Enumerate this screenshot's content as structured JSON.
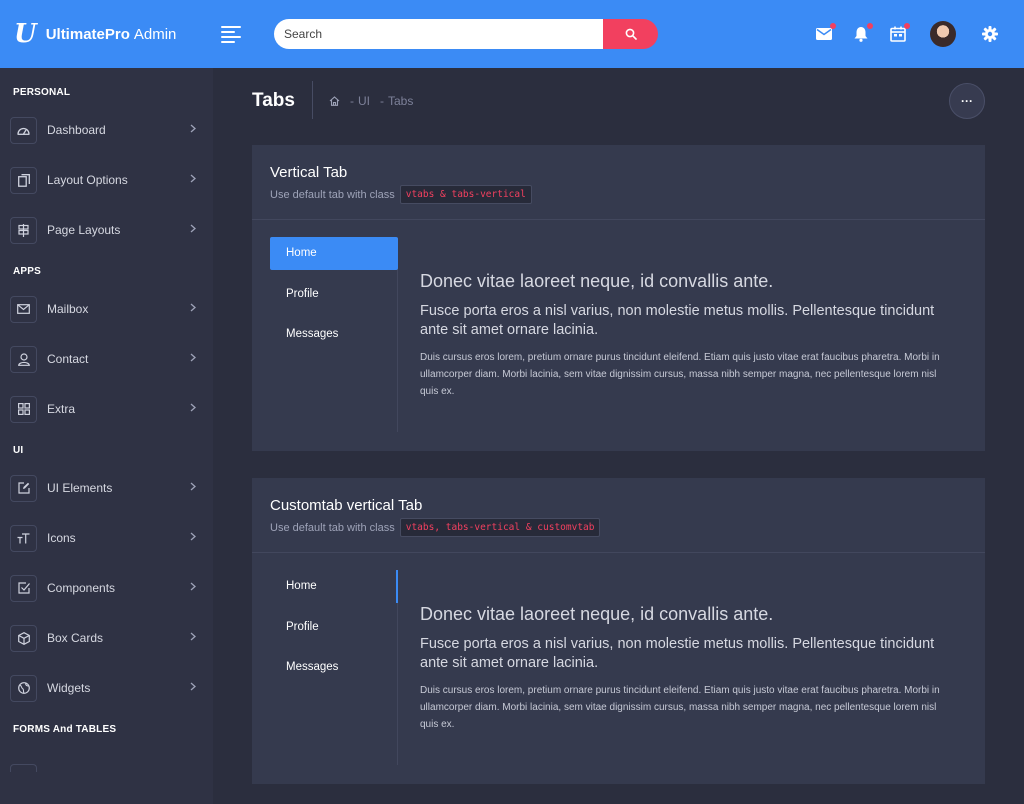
{
  "brand": {
    "logo": "U",
    "name_bold": "UltimatePro",
    "name_light": "Admin"
  },
  "search": {
    "placeholder": "Search"
  },
  "colors": {
    "primary": "#3b8bf5",
    "danger": "#f2405f",
    "sidebar": "#2f3244",
    "content": "#2b2e3e",
    "card": "#353a4e"
  },
  "sidebar": {
    "sections": [
      {
        "title": "PERSONAL",
        "items": [
          {
            "label": "Dashboard",
            "icon": "speedometer-icon"
          },
          {
            "label": "Layout Options",
            "icon": "copy-icon"
          },
          {
            "label": "Page Layouts",
            "icon": "signpost-icon"
          }
        ]
      },
      {
        "title": "APPS",
        "items": [
          {
            "label": "Mailbox",
            "icon": "mail-icon"
          },
          {
            "label": "Contact",
            "icon": "user-icon"
          },
          {
            "label": "Extra",
            "icon": "grid-icon"
          }
        ]
      },
      {
        "title": "UI",
        "items": [
          {
            "label": "UI Elements",
            "icon": "edit-icon"
          },
          {
            "label": "Icons",
            "icon": "text-size-icon"
          },
          {
            "label": "Components",
            "icon": "checkbox-icon"
          },
          {
            "label": "Box Cards",
            "icon": "box-icon"
          },
          {
            "label": "Widgets",
            "icon": "globe-icon"
          }
        ]
      },
      {
        "title": "FORMS And TABLES",
        "items": []
      }
    ]
  },
  "page": {
    "title": "Tabs",
    "breadcrumb": [
      "UI",
      "Tabs"
    ],
    "more_label": "···"
  },
  "cards": [
    {
      "title": "Vertical Tab",
      "subtitle": "Use default tab with class",
      "code": "vtabs & tabs-vertical",
      "tabs": [
        "Home",
        "Profile",
        "Messages"
      ],
      "active_tab": "Home",
      "heading": "Donec vitae laoreet neque, id convallis ante.",
      "subheading": "Fusce porta eros a nisl varius, non molestie metus mollis. Pellentesque tincidunt ante sit amet ornare lacinia.",
      "paragraph": "Duis cursus eros lorem, pretium ornare purus tincidunt eleifend. Etiam quis justo vitae erat faucibus pharetra. Morbi in ullamcorper diam. Morbi lacinia, sem vitae dignissim cursus, massa nibh semper magna, nec pellentesque lorem nisl quis ex."
    },
    {
      "title": "Customtab vertical Tab",
      "subtitle": "Use default tab with class",
      "code": "vtabs, tabs-vertical & customvtab",
      "tabs": [
        "Home",
        "Profile",
        "Messages"
      ],
      "active_tab": "Home",
      "heading": "Donec vitae laoreet neque, id convallis ante.",
      "subheading": "Fusce porta eros a nisl varius, non molestie metus mollis. Pellentesque tincidunt ante sit amet ornare lacinia.",
      "paragraph": "Duis cursus eros lorem, pretium ornare purus tincidunt eleifend. Etiam quis justo vitae erat faucibus pharetra. Morbi in ullamcorper diam. Morbi lacinia, sem vitae dignissim cursus, massa nibh semper magna, nec pellentesque lorem nisl quis ex."
    }
  ]
}
